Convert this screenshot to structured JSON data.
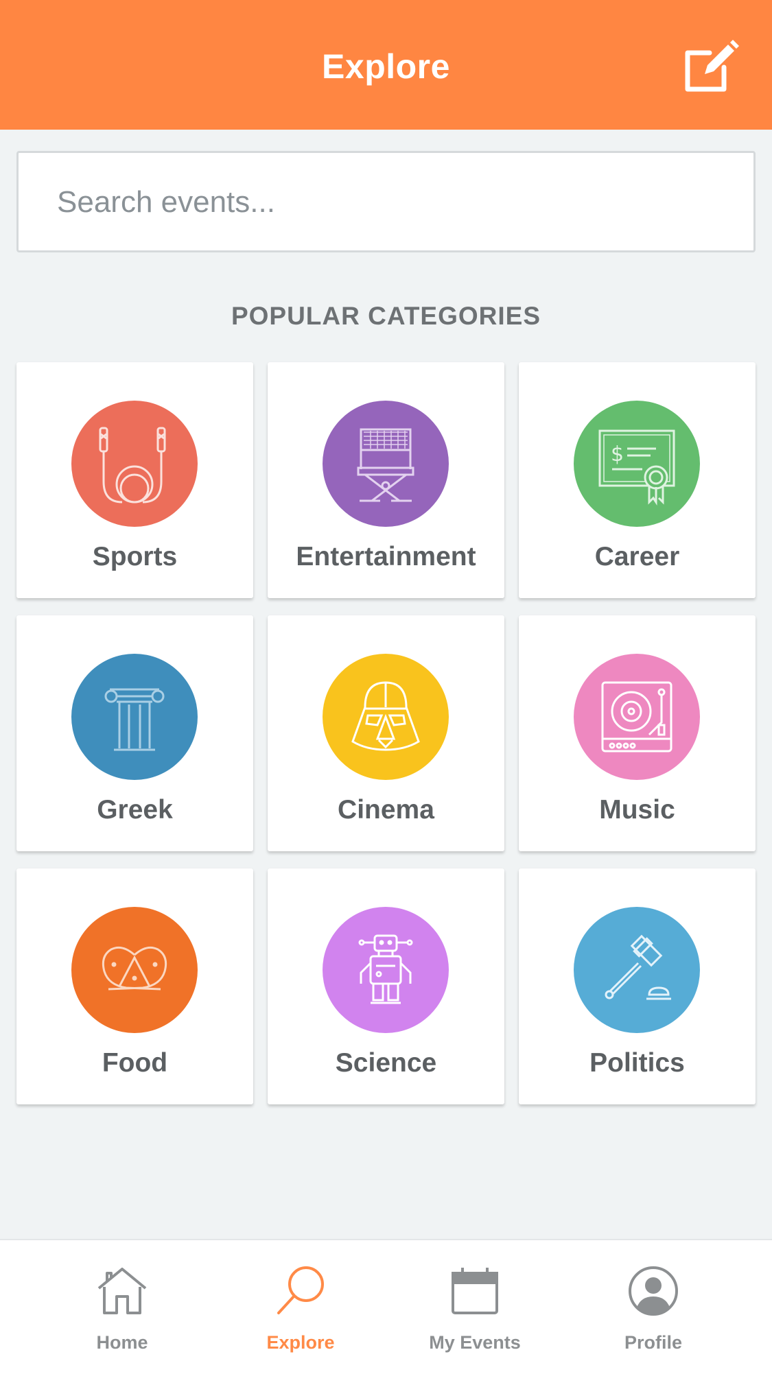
{
  "header": {
    "title": "Explore",
    "compose_icon": "compose-icon"
  },
  "search": {
    "placeholder": "Search events...",
    "value": ""
  },
  "section": {
    "title": "POPULAR CATEGORIES"
  },
  "categories": [
    {
      "label": "Sports",
      "color": "#ec6e5a",
      "icon": "jump-rope-icon"
    },
    {
      "label": "Entertainment",
      "color": "#9565bb",
      "icon": "directors-chair-icon"
    },
    {
      "label": "Career",
      "color": "#64bd6e",
      "icon": "certificate-icon"
    },
    {
      "label": "Greek",
      "color": "#3f8ebc",
      "icon": "greek-column-icon"
    },
    {
      "label": "Cinema",
      "color": "#f9c31d",
      "icon": "darth-vader-helmet-icon"
    },
    {
      "label": "Music",
      "color": "#ee88c0",
      "icon": "turntable-icon"
    },
    {
      "label": "Food",
      "color": "#f07228",
      "icon": "pretzel-icon"
    },
    {
      "label": "Science",
      "color": "#d183ee",
      "icon": "robot-icon"
    },
    {
      "label": "Politics",
      "color": "#56acd6",
      "icon": "gavel-icon"
    }
  ],
  "tabbar": {
    "tabs": [
      {
        "label": "Home",
        "icon": "home-icon",
        "active": false
      },
      {
        "label": "Explore",
        "icon": "search-icon",
        "active": true
      },
      {
        "label": "My Events",
        "icon": "calendar-icon",
        "active": false
      },
      {
        "label": "Profile",
        "icon": "profile-icon",
        "active": false
      }
    ],
    "active_color": "#ff8a47",
    "inactive_color": "#8c8f91"
  },
  "colors": {
    "header_bg": "#ff8642",
    "page_bg": "#f0f3f4"
  }
}
